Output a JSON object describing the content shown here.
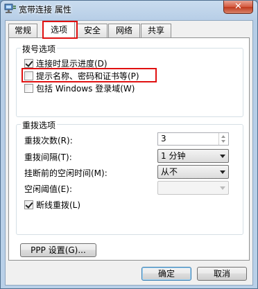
{
  "window": {
    "title": "宽带连接 属性",
    "close_label": "✕"
  },
  "tabs": [
    {
      "label": "常规"
    },
    {
      "label": "选项"
    },
    {
      "label": "安全"
    },
    {
      "label": "网络"
    },
    {
      "label": "共享"
    }
  ],
  "dialing_options": {
    "group_label": "拨号选项",
    "items": [
      {
        "label": "连接时显示进度(D)",
        "checked": true
      },
      {
        "label": "提示名称、密码和证书等(P)",
        "checked": false
      },
      {
        "label": "包括 Windows 登录域(W)",
        "checked": false
      }
    ]
  },
  "redial_options": {
    "group_label": "重拨选项",
    "redial_attempts": {
      "label": "重拨次数(R):",
      "value": "3"
    },
    "redial_interval": {
      "label": "重拨间隔(T):",
      "value": "1 分钟"
    },
    "idle_time": {
      "label": "挂断前的空闲时间(M):",
      "value": "从不"
    },
    "idle_threshold": {
      "label": "空闲阈值(E):",
      "value": ""
    },
    "redial_if_dropped": {
      "label": "断线重拨(L)",
      "checked": true
    }
  },
  "ppp_button": {
    "label": "PPP 设置(G)..."
  },
  "footer": {
    "ok_label": "确定",
    "cancel_label": "取消"
  }
}
